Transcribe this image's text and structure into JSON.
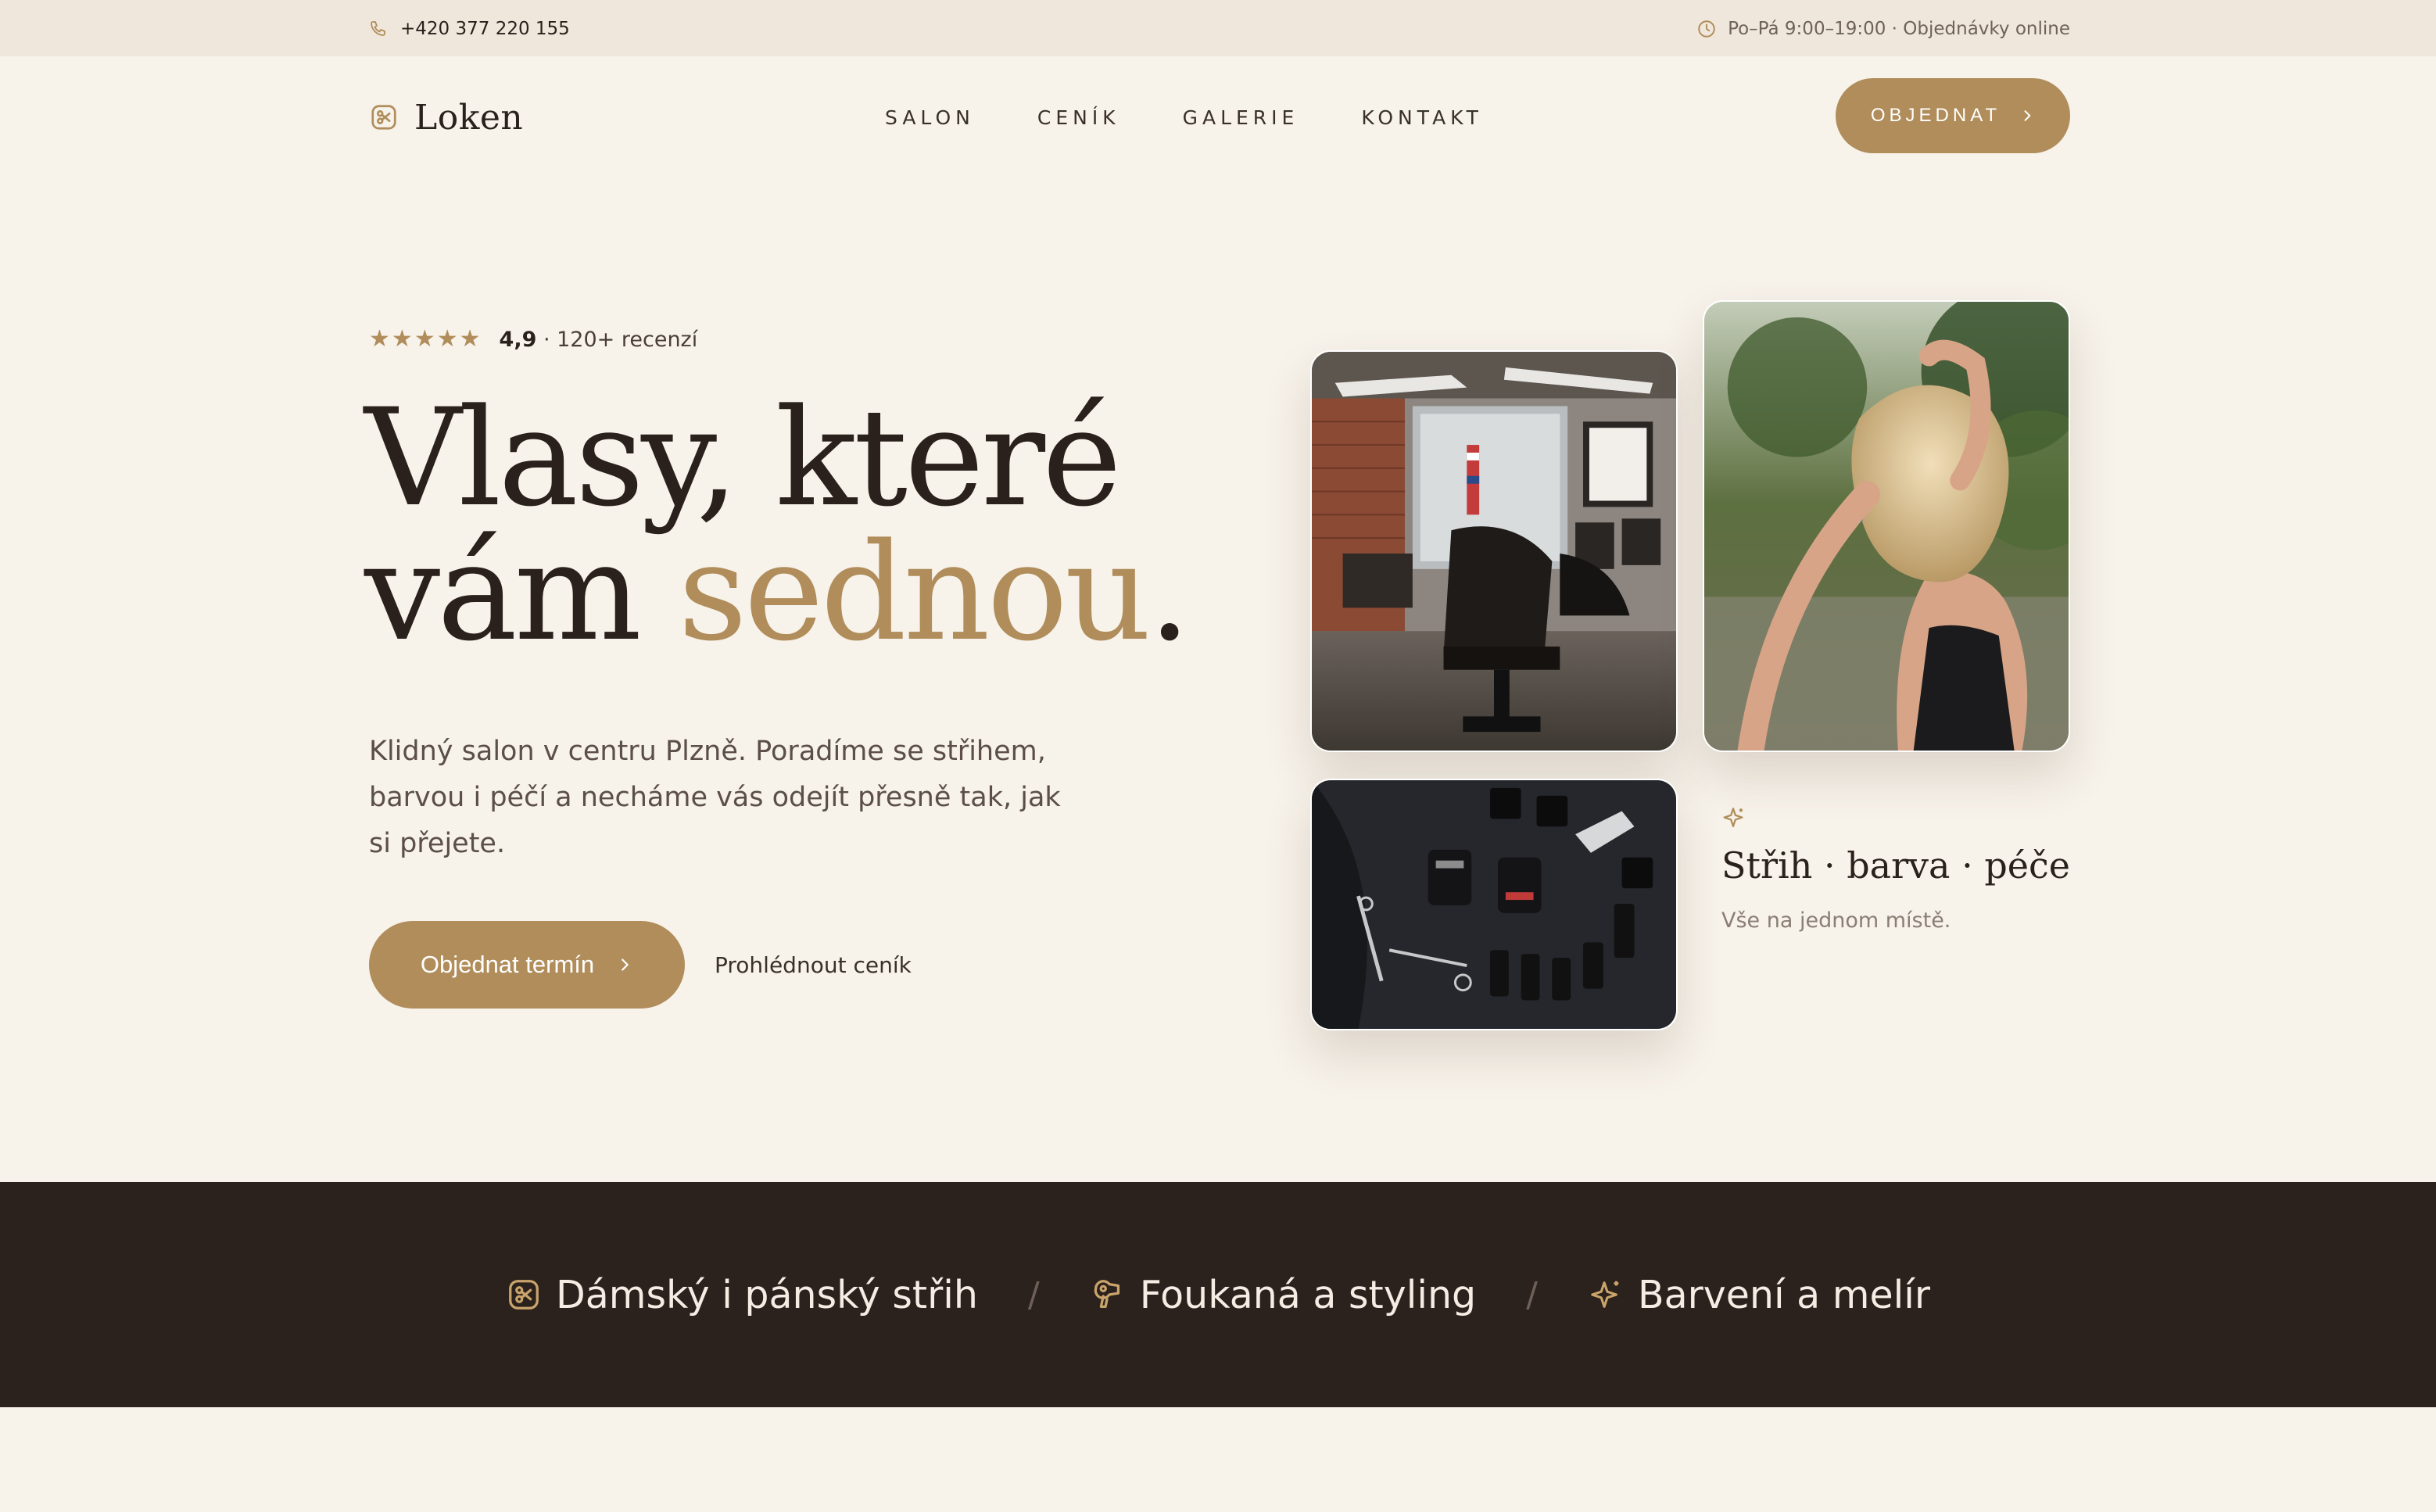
{
  "topbar": {
    "phone": "+420 377 220 155",
    "hours": "Po–Pá 9:00–19:00 · Objednávky online",
    "icons": [
      "phone-icon",
      "clock-icon"
    ]
  },
  "brand": {
    "name": "Loken",
    "icon": "scissors-badge-icon"
  },
  "nav": {
    "items": [
      {
        "label": "SALON"
      },
      {
        "label": "CENÍK"
      },
      {
        "label": "GALERIE"
      },
      {
        "label": "KONTAKT"
      }
    ],
    "cta_label": "OBJEDNAT"
  },
  "hero": {
    "rating": {
      "stars_count": 5,
      "score": "4,9",
      "reviews": "· 120+ recenzí"
    },
    "headline_line1": "Vlasy, které",
    "headline_line2_plain": "vám ",
    "headline_line2_accent": "sednou",
    "headline_line2_end": ".",
    "lead": "Klidný salon v centru Plzně. Poradíme se střihem, barvou i péčí a necháme vás odejít přesně tak, jak si přejete.",
    "primary_cta": "Objednat termín",
    "secondary_cta": "Prohlédnout ceník"
  },
  "gallery": {
    "tag_icon": "sparkle-icon",
    "tag_title": "Střih · barva · péče",
    "tag_subtitle": "Vše na jednom místě."
  },
  "services": {
    "items": [
      {
        "label": "Dámský i pánský střih",
        "icon": "scissors-badge-icon"
      },
      {
        "label": "Foukaná a styling",
        "icon": "hair-dryer-icon"
      },
      {
        "label": "Barvení a melír",
        "icon": "sparkle-icon"
      }
    ],
    "separator": "/"
  },
  "colors": {
    "background": "#f7f2ea",
    "topbar": "#efe7dc",
    "accent": "#b08d5a",
    "dark": "#2b211d",
    "text": "#2a211c"
  }
}
